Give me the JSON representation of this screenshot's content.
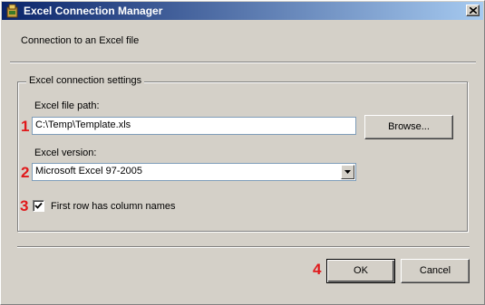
{
  "window": {
    "title": "Excel Connection Manager",
    "close_icon": "close-icon",
    "app_icon": "excel-package-icon"
  },
  "intro_text": "Connection to an Excel file",
  "settings": {
    "group_title": "Excel connection settings",
    "file_path_label": "Excel file path:",
    "file_path_value": "C:\\Temp\\Template.xls",
    "browse_label": "Browse...",
    "version_label": "Excel version:",
    "version_value": "Microsoft Excel 97-2005",
    "first_row_label": "First row has column names",
    "first_row_checked": true
  },
  "annotations": {
    "badge_1": "1",
    "badge_2": "2",
    "badge_3": "3",
    "badge_4": "4",
    "color": "#e0191b"
  },
  "buttons": {
    "ok_label": "OK",
    "cancel_label": "Cancel"
  }
}
